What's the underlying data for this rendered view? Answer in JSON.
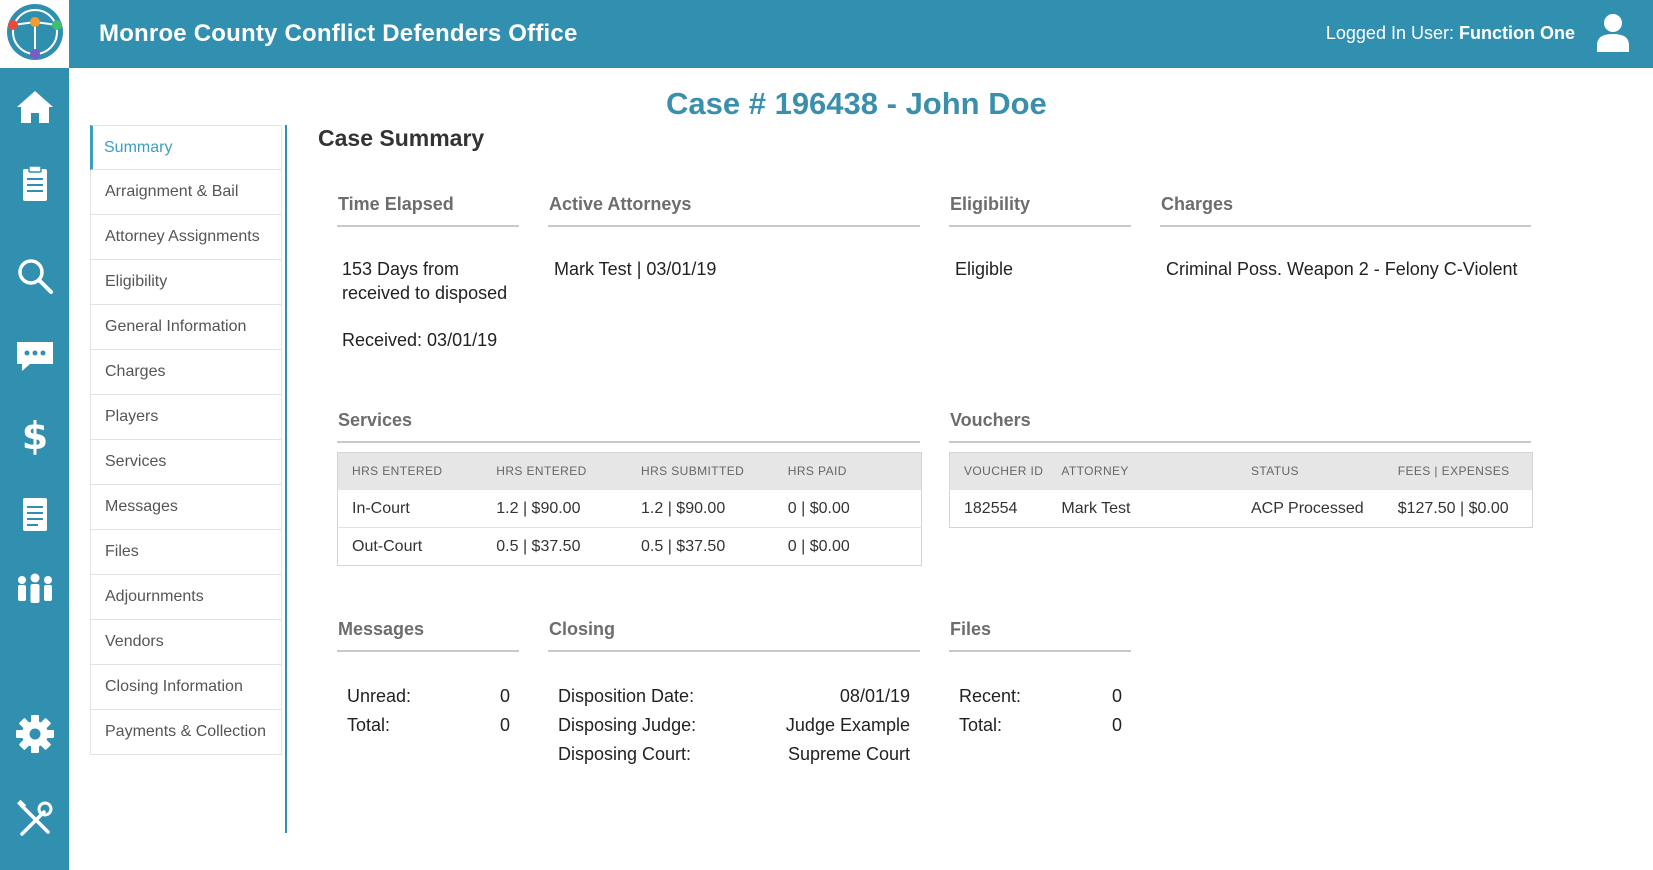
{
  "header": {
    "title": "Monroe County Conflict Defenders Office",
    "user_label": "Logged In User:",
    "user_name": "Function One"
  },
  "rail": {
    "icons": [
      "home-icon",
      "clipboard-icon",
      "search-icon",
      "messages-icon",
      "dollar-icon",
      "document-icon",
      "people-icon",
      "gear-icon",
      "tools-icon"
    ]
  },
  "case_title": "Case # 196438 - John Doe",
  "page_heading": "Case Summary",
  "subnav": {
    "items": [
      "Summary",
      "Arraignment & Bail",
      "Attorney Assignments",
      "Eligibility",
      "General Information",
      "Charges",
      "Players",
      "Services",
      "Messages",
      "Files",
      "Adjournments",
      "Vendors",
      "Closing Information",
      "Payments & Collection"
    ],
    "active": "Summary"
  },
  "time_elapsed": {
    "title": "Time Elapsed",
    "line1": "153 Days from",
    "line2": "received to disposed",
    "received": "Received: 03/01/19"
  },
  "active_attorneys": {
    "title": "Active Attorneys",
    "value": "Mark Test | 03/01/19"
  },
  "eligibility": {
    "title": "Eligibility",
    "value": "Eligible"
  },
  "charges": {
    "title": "Charges",
    "value": "Criminal Poss. Weapon 2 - Felony C-Violent"
  },
  "services": {
    "title": "Services",
    "headers": [
      "HRS ENTERED",
      "HRS ENTERED",
      "HRS SUBMITTED",
      "HRS PAID"
    ],
    "rows": [
      [
        "In-Court",
        "1.2 | $90.00",
        "1.2 | $90.00",
        "0 | $0.00"
      ],
      [
        "Out-Court",
        "0.5 | $37.50",
        "0.5 | $37.50",
        "0 | $0.00"
      ]
    ]
  },
  "vouchers": {
    "title": "Vouchers",
    "headers": [
      "VOUCHER ID",
      "ATTORNEY",
      "STATUS",
      "FEES | EXPENSES"
    ],
    "rows": [
      [
        "182554",
        "Mark Test",
        "ACP Processed",
        "$127.50 | $0.00"
      ]
    ]
  },
  "messages": {
    "title": "Messages",
    "unread_label": "Unread:",
    "unread": "0",
    "total_label": "Total:",
    "total": "0"
  },
  "closing": {
    "title": "Closing",
    "disposition_date_label": "Disposition Date:",
    "disposition_date": "08/01/19",
    "judge_label": "Disposing Judge:",
    "judge": "Judge Example",
    "court_label": "Disposing Court:",
    "court": "Supreme Court"
  },
  "files": {
    "title": "Files",
    "recent_label": "Recent:",
    "recent": "0",
    "total_label": "Total:",
    "total": "0"
  }
}
